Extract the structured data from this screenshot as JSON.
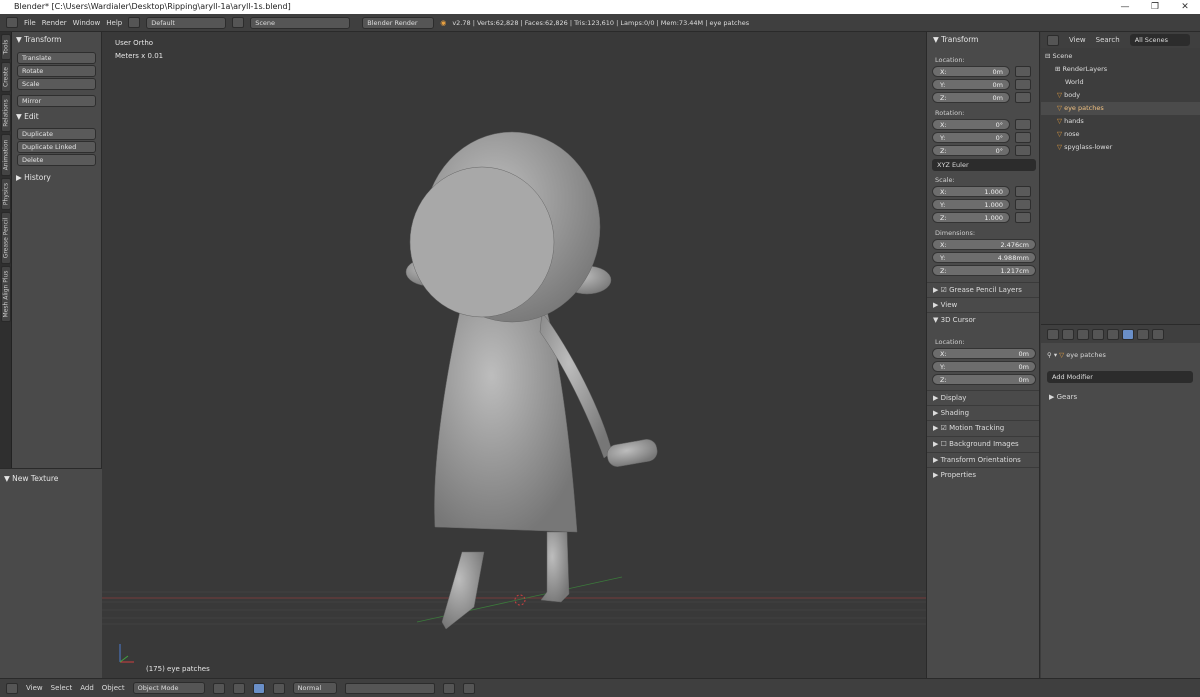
{
  "window": {
    "title": "Blender* [C:\\Users\\Wardialer\\Desktop\\Ripping\\aryll-1a\\aryll-1s.blend]",
    "min": "—",
    "max": "❐",
    "close": "✕"
  },
  "menu": {
    "items": [
      "File",
      "Render",
      "Window",
      "Help"
    ],
    "layout": "Default",
    "scene": "Scene",
    "engine": "Blender Render",
    "stats": "v2.78 | Verts:62,828 | Faces:62,826 | Tris:123,610 | Lamps:0/0 | Mem:73.44M | eye patches"
  },
  "vtabs": [
    "Tools",
    "Create",
    "Relations",
    "Animation",
    "Physics",
    "Grease Pencil",
    "Mesh Align Plus"
  ],
  "toolshelf": {
    "transform_header": "Transform",
    "translate": "Translate",
    "rotate": "Rotate",
    "scale": "Scale",
    "mirror": "Mirror",
    "edit_header": "Edit",
    "duplicate": "Duplicate",
    "duplicate_linked": "Duplicate Linked",
    "delete": "Delete",
    "history_header": "History",
    "texture_header": "New Texture"
  },
  "viewport": {
    "view_name": "User Ortho",
    "units": "Meters x 0.01",
    "object_label": "(175) eye patches"
  },
  "npanel": {
    "transform_header": "Transform",
    "location_label": "Location:",
    "location": [
      {
        "axis": "X:",
        "value": "0m"
      },
      {
        "axis": "Y:",
        "value": "0m"
      },
      {
        "axis": "Z:",
        "value": "0m"
      }
    ],
    "rotation_label": "Rotation:",
    "rotation": [
      {
        "axis": "X:",
        "value": "0°"
      },
      {
        "axis": "Y:",
        "value": "0°"
      },
      {
        "axis": "Z:",
        "value": "0°"
      }
    ],
    "rotation_mode": "XYZ Euler",
    "scale_label": "Scale:",
    "scale": [
      {
        "axis": "X:",
        "value": "1.000"
      },
      {
        "axis": "Y:",
        "value": "1.000"
      },
      {
        "axis": "Z:",
        "value": "1.000"
      }
    ],
    "dimensions_label": "Dimensions:",
    "dimensions": [
      {
        "axis": "X:",
        "value": "2.476cm"
      },
      {
        "axis": "Y:",
        "value": "4.988mm"
      },
      {
        "axis": "Z:",
        "value": "1.217cm"
      }
    ],
    "grease_pencil": "Grease Pencil Layers",
    "view": "View",
    "cursor_header": "3D Cursor",
    "cursor_location_label": "Location:",
    "cursor": [
      {
        "axis": "X:",
        "value": "0m"
      },
      {
        "axis": "Y:",
        "value": "0m"
      },
      {
        "axis": "Z:",
        "value": "0m"
      }
    ],
    "display": "Display",
    "shading": "Shading",
    "motion_tracking": "Motion Tracking",
    "background_images": "Background Images",
    "transform_orientations": "Transform Orientations",
    "properties": "Properties"
  },
  "outliner": {
    "view": "View",
    "search": "Search",
    "scenes": "All Scenes",
    "rows": [
      "Scene",
      "RenderLayers",
      "World",
      "body",
      "eye patches",
      "hands",
      "nose",
      "spyglass-lower"
    ]
  },
  "properties": {
    "object_name": "eye patches",
    "add_modifier": "Add Modifier",
    "gears": "Gears"
  },
  "bottombar": {
    "view": "View",
    "select": "Select",
    "add": "Add",
    "object": "Object",
    "mode": "Object Mode",
    "pivot": "Normal"
  }
}
